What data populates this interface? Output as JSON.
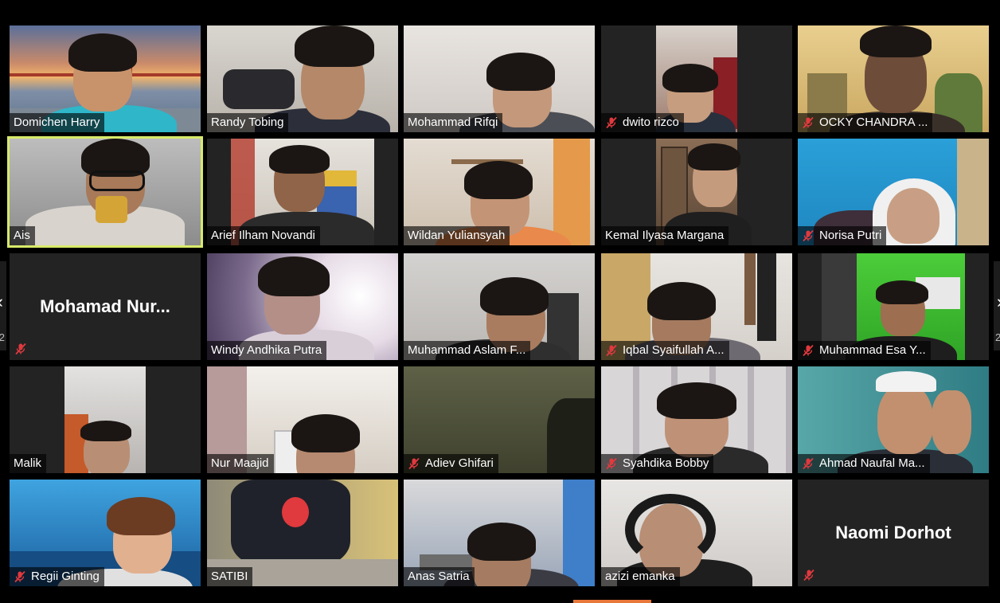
{
  "participants": [
    {
      "name": "Domichen Harry",
      "muted": false
    },
    {
      "name": "Randy Tobing",
      "muted": false
    },
    {
      "name": "Mohammad Rifqi",
      "muted": false
    },
    {
      "name": "dwito rizco",
      "muted": true
    },
    {
      "name": "OCKY CHANDRA ...",
      "muted": true
    },
    {
      "name": "Ais",
      "muted": false,
      "speaking": true
    },
    {
      "name": "Arief Ilham Novandi",
      "muted": false
    },
    {
      "name": "Wildan Yuliansyah",
      "muted": false
    },
    {
      "name": "Kemal Ilyasa Margana",
      "muted": false
    },
    {
      "name": "Norisa Putri",
      "muted": true
    },
    {
      "name": "Mohamad  Nur...",
      "muted": true,
      "video_off": true
    },
    {
      "name": "Windy Andhika Putra",
      "muted": false
    },
    {
      "name": "Muhammad Aslam F...",
      "muted": false
    },
    {
      "name": "Iqbal Syaifullah A...",
      "muted": true
    },
    {
      "name": "Muhammad Esa Y...",
      "muted": true
    },
    {
      "name": "Malik",
      "muted": false
    },
    {
      "name": "Nur Maajid",
      "muted": false
    },
    {
      "name": "Adiev Ghifari",
      "muted": true
    },
    {
      "name": "Syahdika Bobby",
      "muted": true
    },
    {
      "name": "Ahmad Naufal Ma...",
      "muted": true
    },
    {
      "name": "Regii Ginting",
      "muted": true
    },
    {
      "name": "SATIBI",
      "muted": false
    },
    {
      "name": "Anas Satria",
      "muted": false
    },
    {
      "name": "azizi emanka",
      "muted": false
    },
    {
      "name": "Naomi Dorhot",
      "muted": true,
      "video_off": true
    }
  ],
  "pagination": {
    "prev_page": "2",
    "next_page": "2"
  },
  "colors": {
    "background": "#000000",
    "active_speaker_border": "#d8ea6a",
    "mute_icon": "#e0393e",
    "accent_bar": "#e8773a"
  }
}
